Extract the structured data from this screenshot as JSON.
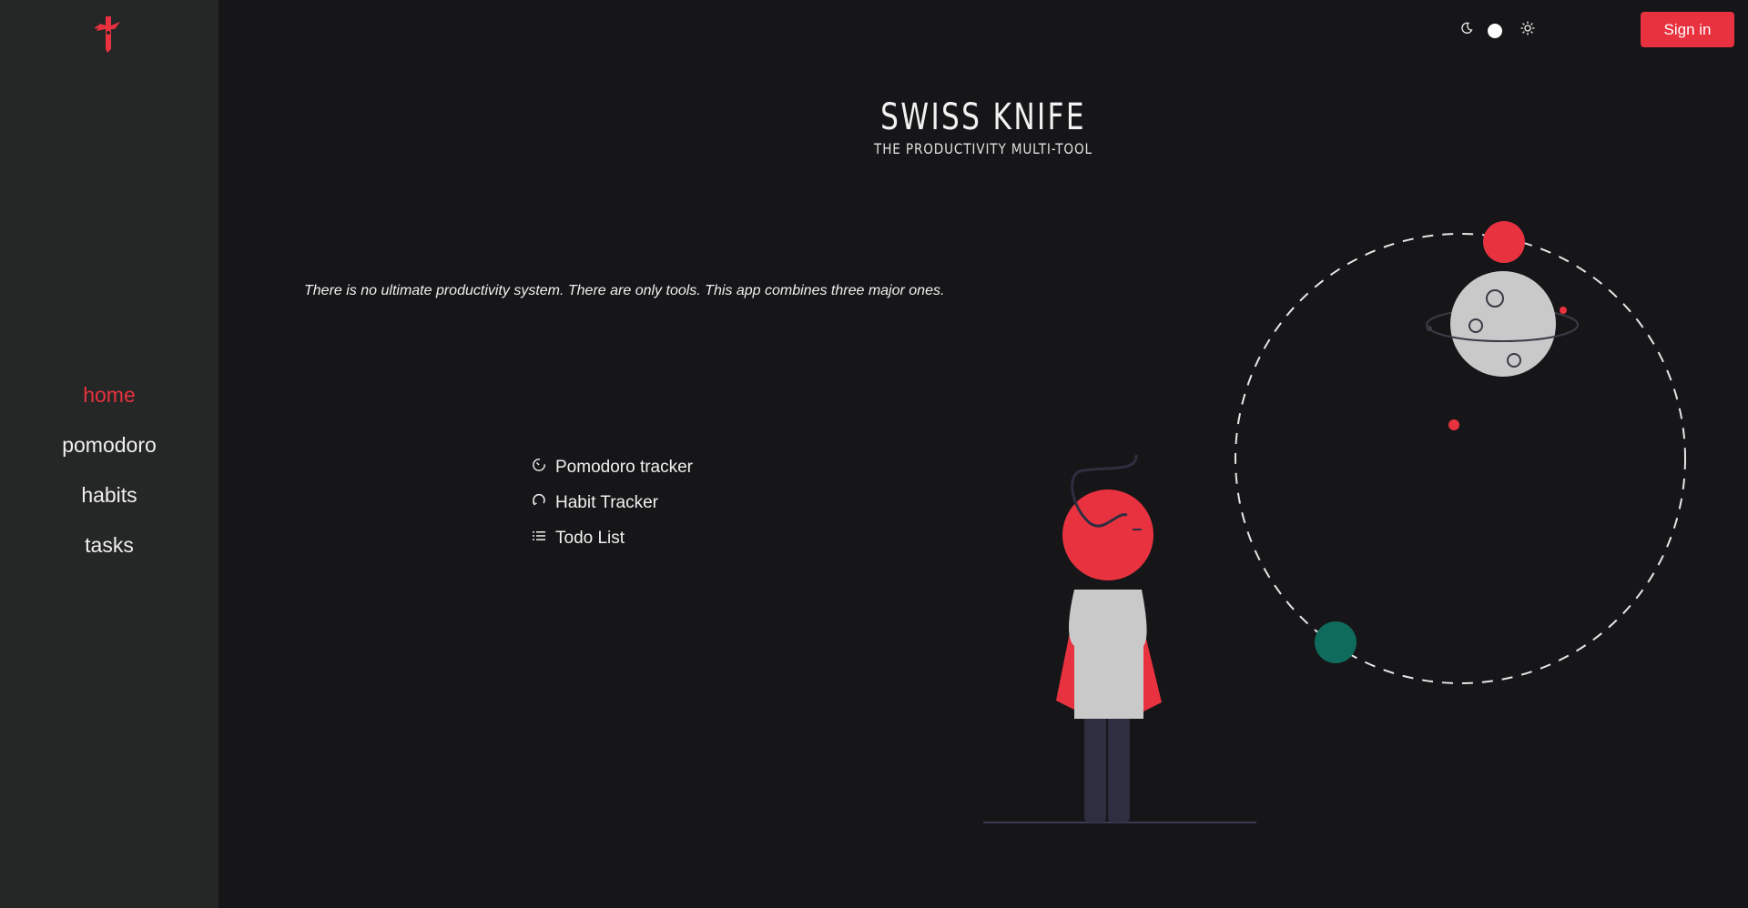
{
  "app": {
    "logo_icon": "swiss-knife-logo-icon",
    "accent": "#e8323f"
  },
  "sidebar": {
    "items": [
      {
        "label": "home",
        "active": true
      },
      {
        "label": "pomodoro",
        "active": false
      },
      {
        "label": "habits",
        "active": false
      },
      {
        "label": "tasks",
        "active": false
      }
    ]
  },
  "topbar": {
    "theme_toggle": {
      "dark_icon": "moon-icon",
      "light_icon": "sun-icon",
      "mode": "dark"
    },
    "signin_label": "Sign in"
  },
  "hero": {
    "title": "SWISS KNIFE",
    "subtitle": "THE PRODUCTIVITY MULTI-TOOL"
  },
  "main": {
    "tagline": "There is no ultimate productivity system. There are only tools. This app combines three major ones.",
    "features": [
      {
        "label": "Pomodoro tracker",
        "icon": "timer-icon"
      },
      {
        "label": "Habit Tracker",
        "icon": "refresh-icon"
      },
      {
        "label": "Todo List",
        "icon": "list-icon"
      }
    ]
  },
  "colors": {
    "background": "#161618",
    "sidebar": "#252626",
    "planet_red": "#e8323f",
    "planet_teal": "#0f6b5c",
    "moon": "#c9c9c9"
  }
}
